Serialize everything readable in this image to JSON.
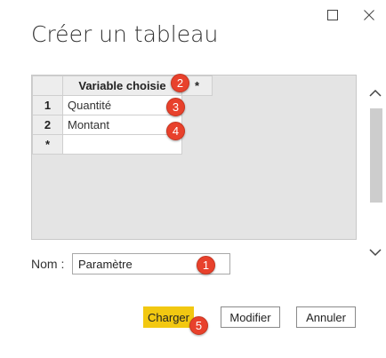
{
  "window": {
    "title": "Créer un tableau",
    "maximize_icon": "maximize-icon",
    "close_icon": "close-icon"
  },
  "grid": {
    "column_header": "Variable choisie",
    "new_column_marker": "*",
    "rows": [
      {
        "row_number": "1",
        "value": "Quantité"
      },
      {
        "row_number": "2",
        "value": "Montant"
      }
    ],
    "new_row_marker": "*"
  },
  "scrollbar": {
    "up_icon": "chevron-up-icon",
    "down_icon": "chevron-down-icon"
  },
  "name_field": {
    "label": "Nom :",
    "value": "Paramètre"
  },
  "buttons": {
    "load": "Charger",
    "edit": "Modifier",
    "cancel": "Annuler"
  },
  "annotations": [
    "1",
    "2",
    "3",
    "4",
    "5"
  ],
  "colors": {
    "load_button": "#f2c811",
    "annotation_badge": "#e8412c"
  }
}
